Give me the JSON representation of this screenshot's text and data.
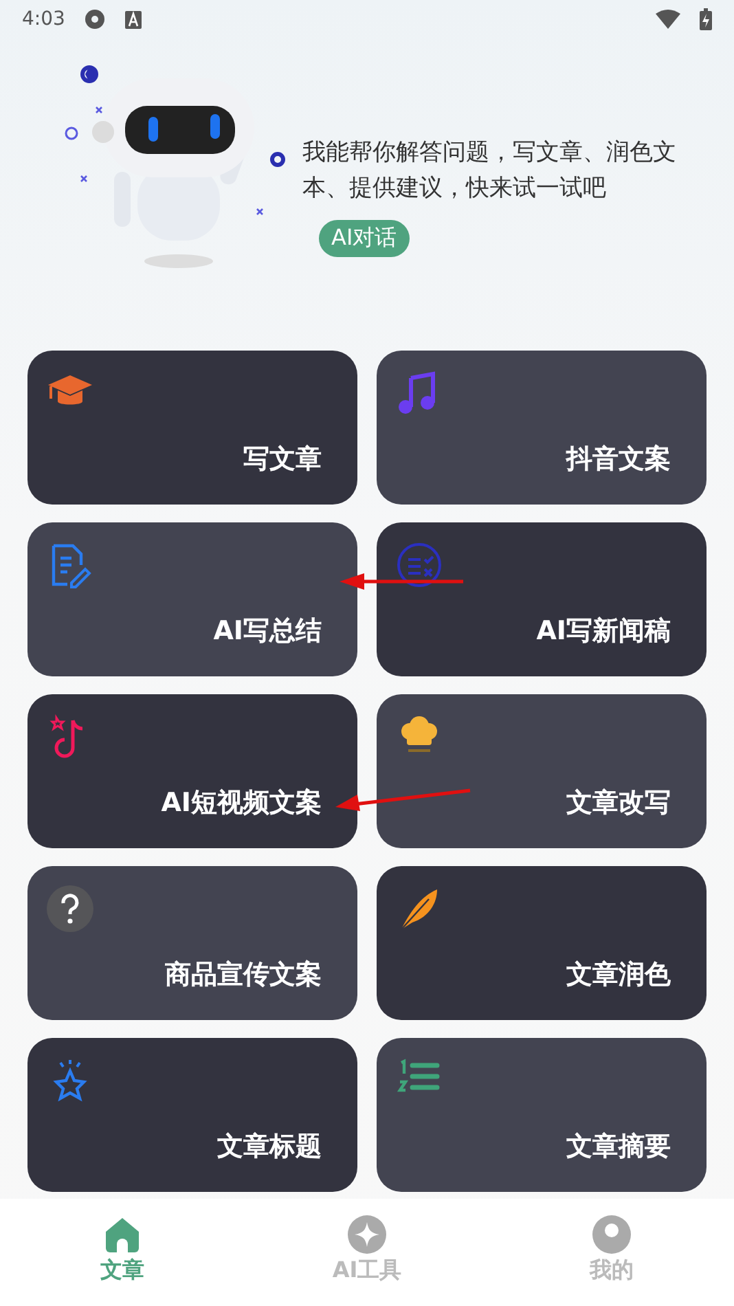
{
  "status_bar": {
    "time": "4:03"
  },
  "hero": {
    "message": "我能帮你解答问题，写文章、润色文本、提供建议，快来试一试吧",
    "button": "AI对话"
  },
  "cards": [
    {
      "label": "写文章",
      "kind": "cap",
      "color": "#33333f"
    },
    {
      "label": "抖音文案",
      "kind": "music",
      "color": "#434451"
    },
    {
      "label": "AI写总结",
      "kind": "doc",
      "color": "#434451"
    },
    {
      "label": "AI写新闻稿",
      "kind": "checklist",
      "color": "#33333f"
    },
    {
      "label": "AI短视频文案",
      "kind": "tiktok",
      "color": "#33333f"
    },
    {
      "label": "文章改写",
      "kind": "chef",
      "color": "#434451"
    },
    {
      "label": "商品宣传文案",
      "kind": "question",
      "color": "#434451"
    },
    {
      "label": "文章润色",
      "kind": "feather",
      "color": "#33333f"
    },
    {
      "label": "文章标题",
      "kind": "star",
      "color": "#33333f"
    },
    {
      "label": "文章摘要",
      "kind": "numbered",
      "color": "#434451"
    }
  ],
  "nav": [
    {
      "label": "文章",
      "kind": "home",
      "selected": true
    },
    {
      "label": "AI工具",
      "kind": "sparkle",
      "selected": false
    },
    {
      "label": "我的",
      "kind": "user",
      "selected": false
    }
  ]
}
